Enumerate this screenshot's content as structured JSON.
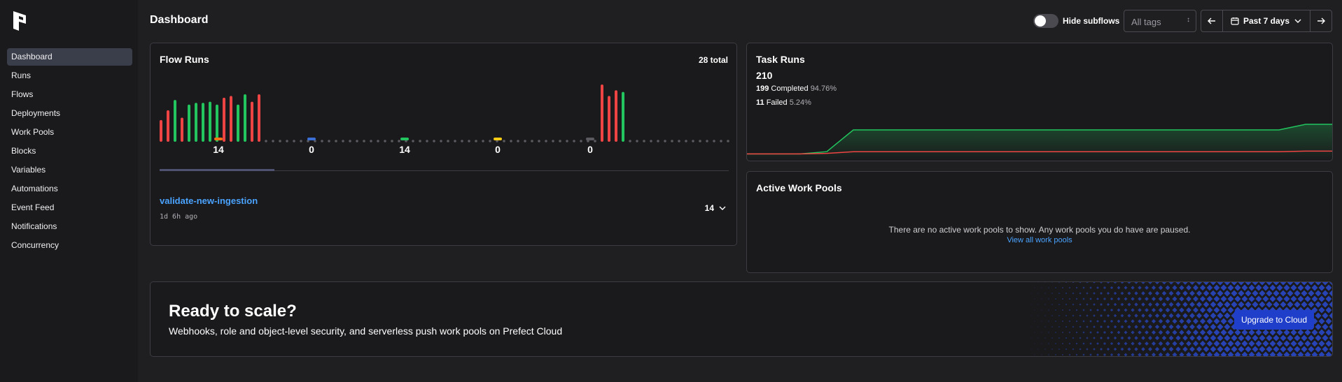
{
  "sidebar": {
    "logo_icon": "prefect-logo-icon",
    "items": [
      {
        "label": "Dashboard",
        "active": true
      },
      {
        "label": "Runs"
      },
      {
        "label": "Flows"
      },
      {
        "label": "Deployments"
      },
      {
        "label": "Work Pools"
      },
      {
        "label": "Blocks"
      },
      {
        "label": "Variables"
      },
      {
        "label": "Automations"
      },
      {
        "label": "Event Feed"
      },
      {
        "label": "Notifications"
      },
      {
        "label": "Concurrency"
      }
    ]
  },
  "header": {
    "title": "Dashboard",
    "hide_subflows_label": "Hide subflows",
    "hide_subflows_on": false,
    "tags_placeholder": "All tags",
    "date_range": "Past 7 days"
  },
  "flow_runs": {
    "title": "Flow Runs",
    "total": "28 total",
    "bar_colors": {
      "completed": "#22c55e",
      "failed": "#ef4444",
      "empty": "#5a5a60"
    },
    "bars": [
      {
        "state": "failed",
        "level": 0.38
      },
      {
        "state": "failed",
        "level": 0.55
      },
      {
        "state": "completed",
        "level": 0.73
      },
      {
        "state": "failed",
        "level": 0.42
      },
      {
        "state": "completed",
        "level": 0.65
      },
      {
        "state": "completed",
        "level": 0.68
      },
      {
        "state": "completed",
        "level": 0.68
      },
      {
        "state": "completed",
        "level": 0.7
      },
      {
        "state": "completed",
        "level": 0.65
      },
      {
        "state": "failed",
        "level": 0.77
      },
      {
        "state": "failed",
        "level": 0.8
      },
      {
        "state": "completed",
        "level": 0.65
      },
      {
        "state": "completed",
        "level": 0.83
      },
      {
        "state": "failed",
        "level": 0.7
      },
      {
        "state": "failed",
        "level": 0.83
      },
      {
        "state": "empty"
      },
      {
        "state": "empty"
      },
      {
        "state": "empty"
      },
      {
        "state": "empty"
      },
      {
        "state": "empty"
      },
      {
        "state": "empty"
      },
      {
        "state": "empty"
      },
      {
        "state": "empty"
      },
      {
        "state": "empty"
      },
      {
        "state": "empty"
      },
      {
        "state": "empty"
      },
      {
        "state": "empty"
      },
      {
        "state": "empty"
      },
      {
        "state": "empty"
      },
      {
        "state": "empty"
      },
      {
        "state": "empty"
      },
      {
        "state": "empty"
      },
      {
        "state": "empty"
      },
      {
        "state": "empty"
      },
      {
        "state": "empty"
      },
      {
        "state": "empty"
      },
      {
        "state": "empty"
      },
      {
        "state": "empty"
      },
      {
        "state": "empty"
      },
      {
        "state": "empty"
      },
      {
        "state": "empty"
      },
      {
        "state": "empty"
      },
      {
        "state": "empty"
      },
      {
        "state": "empty"
      },
      {
        "state": "empty"
      },
      {
        "state": "empty"
      },
      {
        "state": "empty"
      },
      {
        "state": "empty"
      },
      {
        "state": "empty"
      },
      {
        "state": "empty"
      },
      {
        "state": "empty"
      },
      {
        "state": "empty"
      },
      {
        "state": "empty"
      },
      {
        "state": "empty"
      },
      {
        "state": "empty"
      },
      {
        "state": "empty"
      },
      {
        "state": "empty"
      },
      {
        "state": "empty"
      },
      {
        "state": "empty"
      },
      {
        "state": "empty"
      },
      {
        "state": "empty"
      },
      {
        "state": "empty"
      },
      {
        "state": "empty"
      },
      {
        "state": "failed",
        "level": 1.0
      },
      {
        "state": "failed",
        "level": 0.8
      },
      {
        "state": "failed",
        "level": 0.9
      },
      {
        "state": "completed",
        "level": 0.87
      },
      {
        "state": "empty"
      },
      {
        "state": "empty"
      },
      {
        "state": "empty"
      },
      {
        "state": "empty"
      },
      {
        "state": "empty"
      },
      {
        "state": "empty"
      },
      {
        "state": "empty"
      },
      {
        "state": "empty"
      },
      {
        "state": "empty"
      },
      {
        "state": "empty"
      },
      {
        "state": "empty"
      },
      {
        "state": "empty"
      },
      {
        "state": "empty"
      },
      {
        "state": "empty"
      },
      {
        "state": "empty"
      }
    ],
    "states": [
      {
        "count": "14",
        "color": "#f97316"
      },
      {
        "count": "0",
        "color": "#3b6fd6"
      },
      {
        "count": "14",
        "color": "#22c55e"
      },
      {
        "count": "0",
        "color": "#facc15"
      },
      {
        "count": "0",
        "color": "#5a5a60"
      }
    ],
    "flow_name": "validate-new-ingestion",
    "flow_time": "1d 6h ago",
    "flow_count": "14"
  },
  "task_runs": {
    "title": "Task Runs",
    "total": "210",
    "completed_count": "199",
    "completed_label": "Completed",
    "completed_pct": "94.76%",
    "failed_count": "11",
    "failed_label": "Failed",
    "failed_pct": "5.24%",
    "chart_colors": {
      "completed": "#22c55e",
      "failed": "#ef4444"
    },
    "completed_line": [
      0.12,
      0.12,
      0.12,
      0.16,
      0.55,
      0.55,
      0.55,
      0.55,
      0.55,
      0.55,
      0.55,
      0.55,
      0.55,
      0.55,
      0.55,
      0.55,
      0.55,
      0.55,
      0.55,
      0.55,
      0.55,
      0.65,
      0.65
    ],
    "failed_line": [
      0.12,
      0.12,
      0.12,
      0.13,
      0.16,
      0.16,
      0.16,
      0.16,
      0.16,
      0.16,
      0.16,
      0.16,
      0.16,
      0.16,
      0.16,
      0.16,
      0.16,
      0.16,
      0.16,
      0.16,
      0.16,
      0.17,
      0.17
    ]
  },
  "work_pools": {
    "title": "Active Work Pools",
    "message": "There are no active work pools to show. Any work pools you do have are paused.",
    "link": "View all work pools"
  },
  "upsell": {
    "title": "Ready to scale?",
    "description": "Webhooks, role and object-level security, and serverless push work pools on Prefect Cloud",
    "button": "Upgrade to Cloud",
    "pattern_color": "#2a4bd0"
  }
}
